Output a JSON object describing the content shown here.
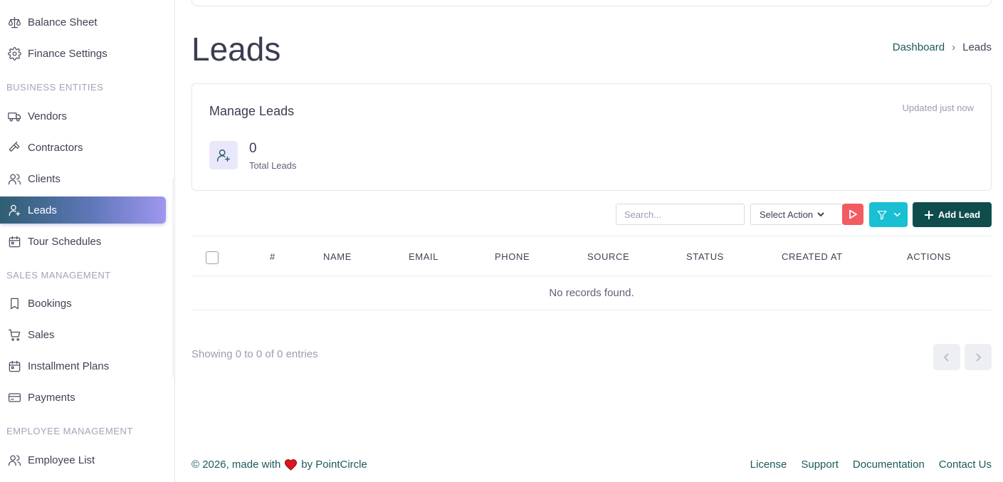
{
  "sidebar": {
    "items": [
      {
        "label": "Balance Sheet",
        "icon": "scale-icon"
      },
      {
        "label": "Finance Settings",
        "icon": "gear-icon"
      },
      {
        "label": "Vendors",
        "icon": "truck-icon"
      },
      {
        "label": "Contractors",
        "icon": "hammer-icon"
      },
      {
        "label": "Clients",
        "icon": "users-icon"
      },
      {
        "label": "Leads",
        "icon": "user-plus-icon",
        "active": true
      },
      {
        "label": "Tour Schedules",
        "icon": "calendar-icon"
      },
      {
        "label": "Bookings",
        "icon": "bookmark-icon"
      },
      {
        "label": "Sales",
        "icon": "cart-icon"
      },
      {
        "label": "Installment Plans",
        "icon": "calendar-icon"
      },
      {
        "label": "Payments",
        "icon": "card-icon"
      },
      {
        "label": "Employee List",
        "icon": "users-icon"
      }
    ],
    "sections": {
      "business": "BUSINESS ENTITIES",
      "sales": "SALES MANAGEMENT",
      "employee": "EMPLOYEE MANAGEMENT"
    }
  },
  "header": {
    "title": "Leads",
    "breadcrumb": {
      "home": "Dashboard",
      "current": "Leads"
    }
  },
  "stats_card": {
    "title": "Manage Leads",
    "updated": "Updated just now",
    "value": "0",
    "label": "Total Leads",
    "icon": "user-plus-icon"
  },
  "toolbar": {
    "search_placeholder": "Search...",
    "select_action": "Select Action",
    "add_label": "Add Lead"
  },
  "table": {
    "columns": [
      "#",
      "NAME",
      "EMAIL",
      "PHONE",
      "SOURCE",
      "STATUS",
      "CREATED AT",
      "ACTIONS"
    ],
    "empty_message": "No records found."
  },
  "pagination": {
    "info": "Showing 0 to 0 of 0 entries"
  },
  "footer": {
    "copyright_prefix": "© 2026, made with",
    "copyright_suffix": "by PointCircle",
    "links": [
      "License",
      "Support",
      "Documentation",
      "Contact Us"
    ]
  },
  "colors": {
    "brand": "#0f4d4d",
    "accent_cyan": "#19bfd3",
    "danger": "#f35b63",
    "active_gradient_start": "#2f5e73",
    "active_gradient_end": "#9f97ef"
  }
}
